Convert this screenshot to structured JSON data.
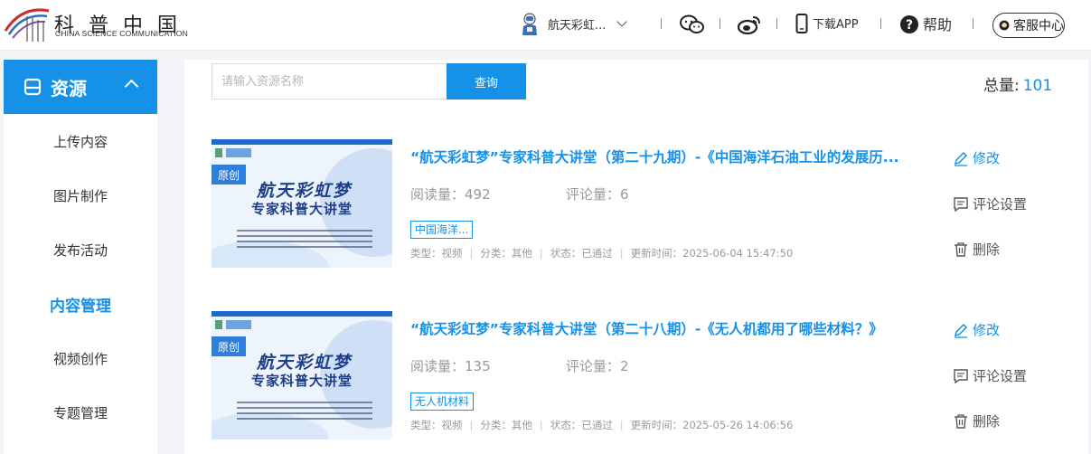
{
  "header": {
    "logo_cn": "科普中国",
    "logo_en": "CHINA SCIENCE COMMUNICATION",
    "user_name": "航天彩虹...",
    "download_label": "下载APP",
    "help_label": "帮助",
    "service_label": "客服中心"
  },
  "sidebar": {
    "section_label": "资源",
    "items": [
      {
        "label": "上传内容"
      },
      {
        "label": "图片制作"
      },
      {
        "label": "发布活动"
      },
      {
        "label": "内容管理"
      },
      {
        "label": "视频创作"
      },
      {
        "label": "专题管理"
      }
    ],
    "active_item": "内容管理"
  },
  "search": {
    "placeholder": "请输入资源名称",
    "value": "",
    "button_label": "查询"
  },
  "total": {
    "label": "总量:",
    "value": "101"
  },
  "items": [
    {
      "badge": "原创",
      "thumb_title_1": "航天彩虹梦",
      "thumb_title_2": "专家科普大讲堂",
      "title": "“航天彩虹梦”专家科普大讲堂（第二十九期）-《中国海洋石油工业的发展历...",
      "reads": "阅读量：492",
      "comments": "评论量：6",
      "tag": "中国海洋...",
      "type": "类型：视频",
      "category": "分类：其他",
      "status": "状态：已通过",
      "updated": "更新时间：2025-06-04 15:47:50",
      "edit_label": "修改",
      "comment_settings_label": "评论设置",
      "delete_label": "删除"
    },
    {
      "badge": "原创",
      "thumb_title_1": "航天彩虹梦",
      "thumb_title_2": "专家科普大讲堂",
      "title": "“航天彩虹梦”专家科普大讲堂（第二十八期）-《无人机都用了哪些材料？》",
      "reads": "阅读量：135",
      "comments": "评论量：2",
      "tag": "无人机材料",
      "type": "类型：视频",
      "category": "分类：其他",
      "status": "状态：已通过",
      "updated": "更新时间：2025-05-26 14:06:56",
      "edit_label": "修改",
      "comment_settings_label": "评论设置",
      "delete_label": "删除"
    }
  ],
  "colors": {
    "accent": "#1591e8",
    "background": "#f3f4f7"
  }
}
